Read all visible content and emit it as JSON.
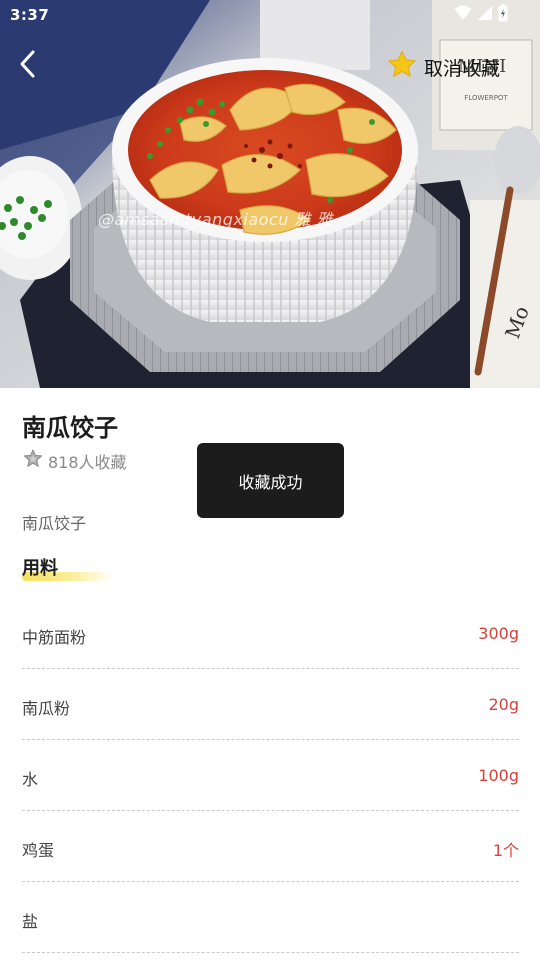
{
  "status_bar": {
    "time": "3:37"
  },
  "header": {
    "unfavorite_label": "取消收藏"
  },
  "hero": {
    "watermark": "@amsash tyangxiaocu 雅 雅"
  },
  "recipe": {
    "title": "南瓜饺子",
    "favorite_count": "818人收藏",
    "description": "南瓜饺子"
  },
  "ingredients_section": {
    "title": "用料",
    "items": [
      {
        "name": "中筋面粉",
        "amount": "300g"
      },
      {
        "name": "南瓜粉",
        "amount": "20g"
      },
      {
        "name": "水",
        "amount": "100g"
      },
      {
        "name": "鸡蛋",
        "amount": "1个"
      },
      {
        "name": "盐",
        "amount": ""
      }
    ]
  },
  "toast": {
    "message": "收藏成功"
  },
  "colors": {
    "accent_red": "#d7413a",
    "highlight_yellow": "#f6df5f",
    "star": "#f5c518",
    "toast_bg": "#1c1c1c"
  },
  "icons": [
    "back-arrow-icon",
    "star-icon",
    "favorites-icon",
    "wifi-icon",
    "signal-icon",
    "battery-icon"
  ]
}
